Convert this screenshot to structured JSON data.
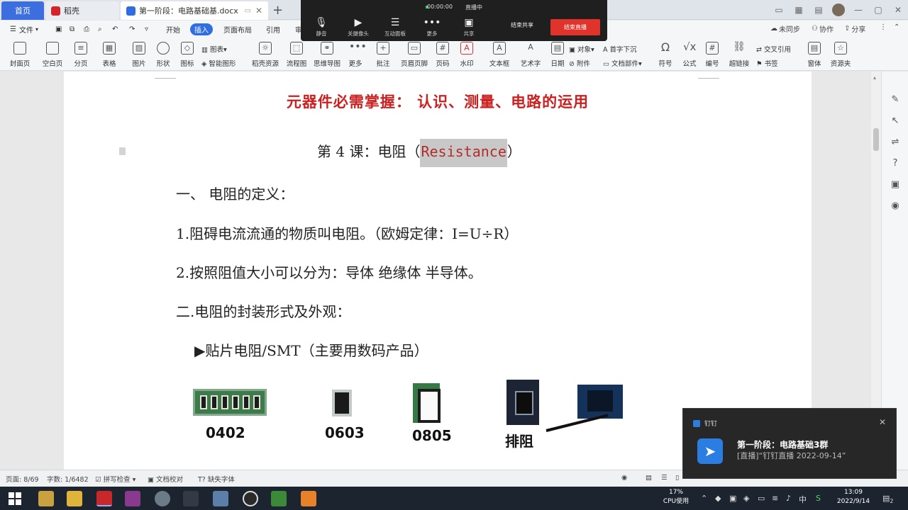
{
  "tabs": {
    "home": "首页",
    "daoke": "稻壳",
    "doc": "第一阶段：电路基础基.docx"
  },
  "menu": {
    "file": "文件",
    "items": [
      "开始",
      "插入",
      "页面布局",
      "引用",
      "审"
    ],
    "active_index": 1,
    "right": {
      "unsync": "未同步",
      "collab": "协作",
      "share": "分享"
    }
  },
  "ribbon": {
    "buttons": [
      {
        "label": "封面页",
        "icon": "cover-icon"
      },
      {
        "label": "空白页",
        "icon": "blank-page-icon"
      },
      {
        "label": "分页",
        "icon": "page-break-icon"
      },
      {
        "label": "表格",
        "icon": "table-icon"
      },
      {
        "label": "图片",
        "icon": "image-icon"
      },
      {
        "label": "形状",
        "icon": "shape-icon"
      },
      {
        "label": "图标",
        "icon": "icons-icon"
      },
      {
        "label": "稻壳资源",
        "icon": "resource-icon"
      },
      {
        "label": "流程图",
        "icon": "flowchart-icon"
      },
      {
        "label": "思维导图",
        "icon": "mindmap-icon"
      },
      {
        "label": "更多",
        "icon": "more-icon"
      },
      {
        "label": "批注",
        "icon": "comment-icon"
      },
      {
        "label": "页眉页脚",
        "icon": "header-footer-icon"
      },
      {
        "label": "页码",
        "icon": "page-number-icon"
      },
      {
        "label": "水印",
        "icon": "watermark-icon"
      },
      {
        "label": "文本框",
        "icon": "textbox-icon"
      },
      {
        "label": "艺术字",
        "icon": "wordart-icon"
      },
      {
        "label": "日期",
        "icon": "date-icon"
      },
      {
        "label": "符号",
        "icon": "symbol-icon"
      },
      {
        "label": "公式",
        "icon": "formula-icon"
      },
      {
        "label": "编号",
        "icon": "numbering-icon"
      },
      {
        "label": "超链接",
        "icon": "hyperlink-icon"
      },
      {
        "label": "窗体",
        "icon": "form-icon"
      },
      {
        "label": "资源夹",
        "icon": "resource-folder-icon"
      }
    ],
    "small": {
      "chart": "图表",
      "smart": "智能图形",
      "object": "对象",
      "attachment": "附件",
      "dropcap": "首字下沉",
      "docparts": "文档部件",
      "crossref": "交叉引用",
      "bookmark": "书签"
    }
  },
  "meeting": {
    "timer": "00:00:00",
    "live": "直播中",
    "tools": [
      {
        "label": "静音",
        "icon": "microphone-icon"
      },
      {
        "label": "关摄像头",
        "icon": "camera-icon"
      },
      {
        "label": "互动面板",
        "icon": "interaction-panel-icon"
      },
      {
        "label": "更多",
        "icon": "more-dots-icon"
      },
      {
        "label": "共享",
        "icon": "share-screen-icon"
      }
    ],
    "end_share": "结束共享",
    "end_live": "结束直播"
  },
  "document": {
    "heading": "元器件必需掌握：  认识、测量、电路的运用",
    "lesson_prefix": "第 4 课：电阻（",
    "lesson_highlight": "Resistance",
    "lesson_suffix": "）",
    "lines": [
      "一、  电阻的定义：",
      "1.阻碍电流流通的物质叫电阻。（欧姆定律：I=U÷R）",
      "2.按照阻值大小可以分为：导体   绝缘体   半导体。",
      "二.电阻的封装形式及外观：",
      "▶贴片电阻/SMT（主要用数码产品）"
    ],
    "components": [
      "0402",
      "0603",
      "0805",
      "排阻"
    ]
  },
  "status": {
    "page": "页面: 8/69",
    "words": "字数: 1/6482",
    "spell": "拼写检查",
    "proof": "文档校对",
    "missing_font": "缺失字体"
  },
  "notification": {
    "app": "钉钉",
    "title": "第一阶段：电路基础3群",
    "body": "[直播]“钉钉直播 2022-09-14”"
  },
  "taskbar": {
    "cpu_value": "17%",
    "cpu_label": "CPU使用",
    "ime": "中",
    "time": "13:09",
    "date": "2022/9/14",
    "notif_count": "2"
  }
}
